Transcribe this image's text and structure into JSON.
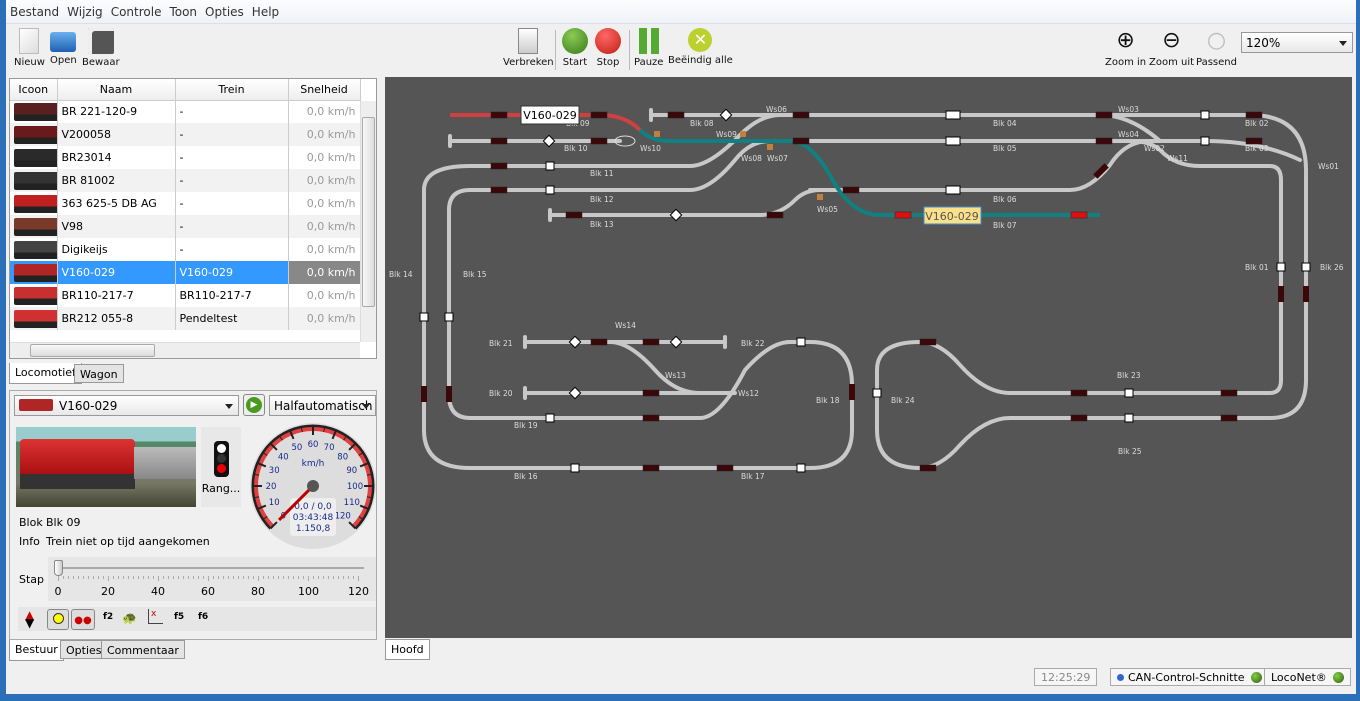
{
  "menu": [
    "Bestand",
    "Wijzig",
    "Controle",
    "Toon",
    "Opties",
    "Help"
  ],
  "toolbar": {
    "new": "Nieuw",
    "open": "Open",
    "save": "Bewaar",
    "disconnect": "Verbreken",
    "start": "Start",
    "stop": "Stop",
    "pause": "Pauze",
    "end_all": "Beëindig alle",
    "zoom_in": "Zoom in",
    "zoom_out": "Zoom uit",
    "fit": "Passend",
    "zoom_level": "120%"
  },
  "loco_table": {
    "columns": [
      "Icoon",
      "Naam",
      "Trein",
      "Snelheid"
    ],
    "rows": [
      {
        "name": "BR 221-120-9",
        "train": "-",
        "speed": "0,0 km/h",
        "color": "#5a2020"
      },
      {
        "name": "V200058",
        "train": "-",
        "speed": "0,0 km/h",
        "color": "#6a1a1a"
      },
      {
        "name": "BR23014",
        "train": "-",
        "speed": "0,0 km/h",
        "color": "#2a2a2a"
      },
      {
        "name": "BR 81002",
        "train": "-",
        "speed": "0,0 km/h",
        "color": "#333"
      },
      {
        "name": "363 625-5 DB AG",
        "train": "-",
        "speed": "0,0 km/h",
        "color": "#c02020"
      },
      {
        "name": "V98",
        "train": "-",
        "speed": "0,0 km/h",
        "color": "#7a3a2a"
      },
      {
        "name": "Digikeijs",
        "train": "-",
        "speed": "0,0 km/h",
        "color": "#444"
      },
      {
        "name": "V160-029",
        "train": "V160-029",
        "speed": "0,0 km/h",
        "color": "#b02525",
        "selected": true
      },
      {
        "name": "BR110-217-7",
        "train": "BR110-217-7",
        "speed": "0,0 km/h",
        "color": "#c83030"
      },
      {
        "name": "BR212 055-8",
        "train": "Pendeltest",
        "speed": "0,0 km/h",
        "color": "#d03030"
      }
    ]
  },
  "list_tabs": [
    "Locomotief",
    "Wagon"
  ],
  "control": {
    "loco": "V160-029",
    "mode": "Halfautomatisch",
    "signal_label": "Rang...",
    "block_label": "Blok",
    "block_value": "Blk 09",
    "info_label": "Info",
    "info_value": "Trein niet op tijd aangekomen",
    "gauge": {
      "unit": "km/h",
      "ticks": [
        "0",
        "10",
        "20",
        "30",
        "40",
        "50",
        "60",
        "70",
        "80",
        "90",
        "100",
        "110",
        "120"
      ],
      "speed": 0,
      "readout1": "0,0 / 0,0",
      "readout2": "03:43:48",
      "readout3": "1.150,8"
    },
    "step_label": "Stap",
    "slider_ticks": [
      "0",
      "20",
      "40",
      "60",
      "80",
      "100",
      "120"
    ],
    "slider_value": 0,
    "functions": [
      "f2",
      "f5",
      "f6"
    ]
  },
  "bottom_tabs": [
    "Bestuur",
    "Opties",
    "Commentaar"
  ],
  "canvas": {
    "tab": "Hoofd",
    "train_labels": [
      "V160-029",
      "V160-029"
    ],
    "labels": [
      "Blk 09",
      "Blk 08",
      "Ws06",
      "Blk 10",
      "Ws10",
      "Ws09",
      "Ws08",
      "Ws07",
      "Blk 11",
      "Blk 12",
      "Blk 13",
      "Ws05",
      "Blk 04",
      "Blk 05",
      "Blk 06",
      "Blk 07",
      "Ws03",
      "Ws04",
      "Ws02",
      "Ws11",
      "Blk 02",
      "Blk 03",
      "Ws01",
      "Blk 01",
      "Blk 26",
      "Blk 14",
      "Blk 15",
      "Ws14",
      "Blk 21",
      "Blk 22",
      "Ws13",
      "Blk 20",
      "Ws12",
      "Blk 19",
      "Blk 18",
      "Blk 16",
      "Blk 17",
      "Blk 24",
      "Blk 23",
      "Blk 25"
    ]
  },
  "status": {
    "time": "12:25:29",
    "interface1": "CAN-Control-Schnitte",
    "interface2": "LocoNet®"
  }
}
